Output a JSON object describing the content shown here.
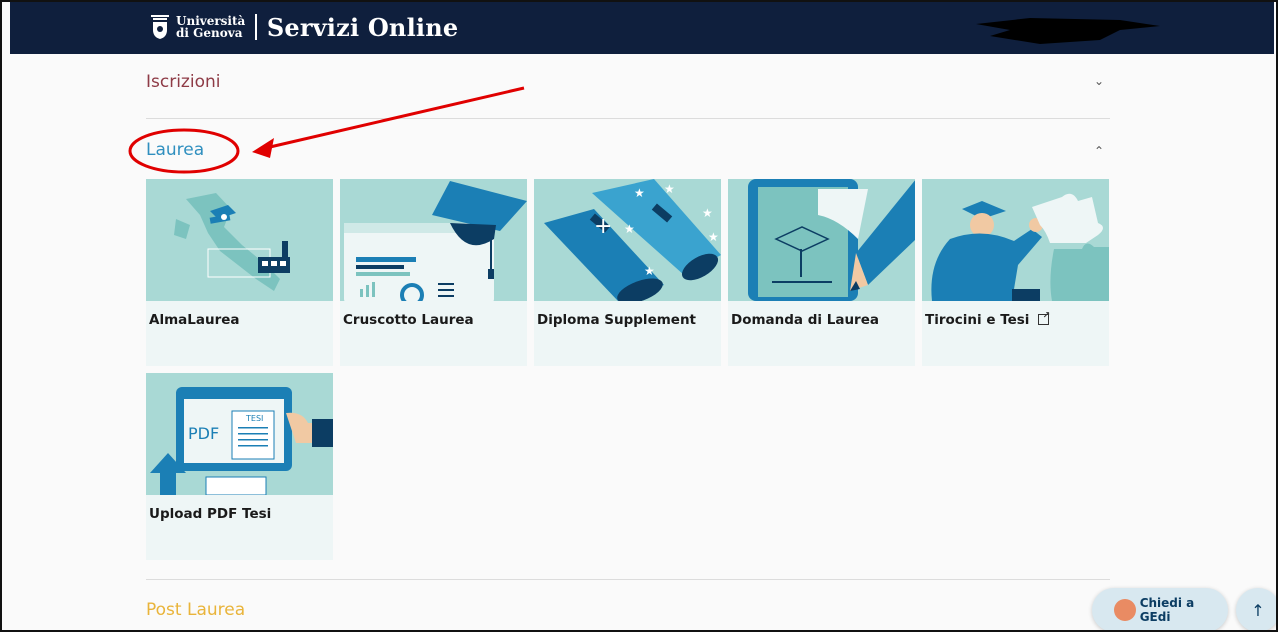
{
  "header": {
    "university_line1": "Università",
    "university_line2": "di Genova",
    "title": "Servizi Online",
    "bg_color": "#0f1f3d"
  },
  "sections": [
    {
      "title": "Iscrizioni",
      "expanded": false,
      "color": "#8e3b46",
      "chevron_icon": "chevron-down-icon",
      "chevron": "⌄"
    },
    {
      "title": "Laurea",
      "expanded": true,
      "color": "#2f8fbf",
      "chevron_icon": "chevron-up-icon",
      "chevron": "⌃"
    },
    {
      "title": "Post Laurea",
      "expanded": false,
      "color": "#e9b43a"
    }
  ],
  "laurea_cards": [
    {
      "label": "AlmaLaurea",
      "icon": "italy-map-graduation-icon"
    },
    {
      "label": "Cruscotto Laurea",
      "icon": "dashboard-graduation-icon"
    },
    {
      "label": "Diploma Supplement",
      "icon": "diploma-scrolls-icon"
    },
    {
      "label": "Domanda di Laurea",
      "icon": "tablet-pencil-icon"
    },
    {
      "label": "Tirocini e Tesi",
      "icon": "graduate-puzzle-icon",
      "external_icon": "external-link-icon"
    },
    {
      "label": "Upload PDF Tesi",
      "icon": "upload-pdf-icon"
    }
  ],
  "upload_art": {
    "pdf": "PDF",
    "tesi": "TESI"
  },
  "floating": {
    "chat_label": "Chiedi a GEdi",
    "back_to_top_icon": "arrow-up-icon",
    "back_to_top": "↑"
  },
  "colors": {
    "accent": "#2f8fbf",
    "card_art_bg": "#a9d9d5",
    "annotation": "#e00000"
  }
}
